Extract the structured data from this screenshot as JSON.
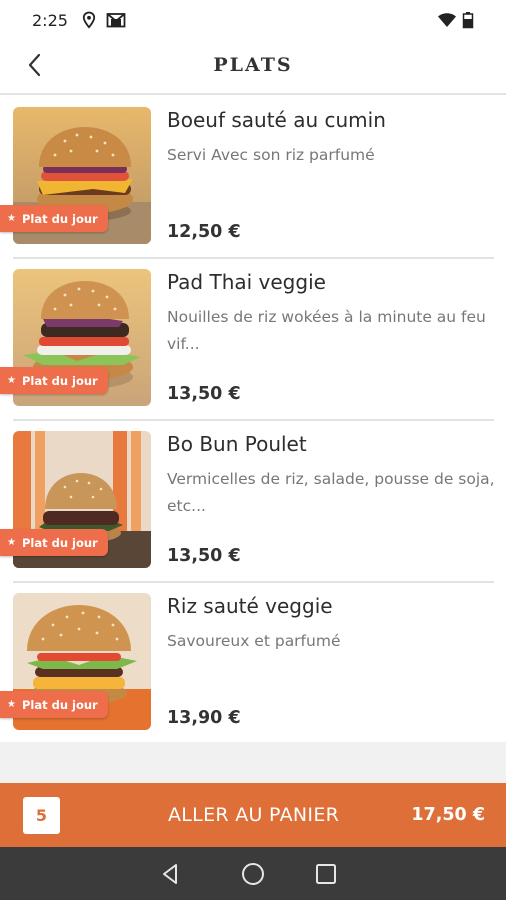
{
  "status_bar": {
    "time": "2:25",
    "icons": [
      "location-icon",
      "gmail-icon",
      "wifi-icon",
      "battery-icon"
    ]
  },
  "header": {
    "title": "PLATS",
    "back_icon": "chevron-left-icon"
  },
  "dishes": [
    {
      "name": "Boeuf sauté au cumin",
      "description": "Servi Avec son riz parfumé",
      "price": "12,50 €",
      "badge": "Plat du jour",
      "badge_icon": "star-icon"
    },
    {
      "name": "Pad Thai veggie",
      "description": "Nouilles de riz wokées à la minute au feu vif...",
      "price": "13,50 €",
      "badge": "Plat du jour",
      "badge_icon": "star-icon"
    },
    {
      "name": "Bo Bun Poulet",
      "description": "Vermicelles de riz, salade, pousse de soja, etc...",
      "price": "13,50 €",
      "badge": "Plat du jour",
      "badge_icon": "star-icon"
    },
    {
      "name": "Riz sauté veggie",
      "description": "Savoureux et parfumé",
      "price": "13,90 €",
      "badge": "Plat du jour",
      "badge_icon": "star-icon"
    }
  ],
  "cart": {
    "count": "5",
    "label": "ALLER AU PANIER",
    "total": "17,50 €"
  },
  "nav_bar": {
    "buttons": [
      "back-triangle-icon",
      "home-circle-icon",
      "recents-square-icon"
    ]
  },
  "colors": {
    "accent": "#df6f38",
    "badge": "#ee6e4c",
    "nav_bar": "#3b3b3b"
  }
}
